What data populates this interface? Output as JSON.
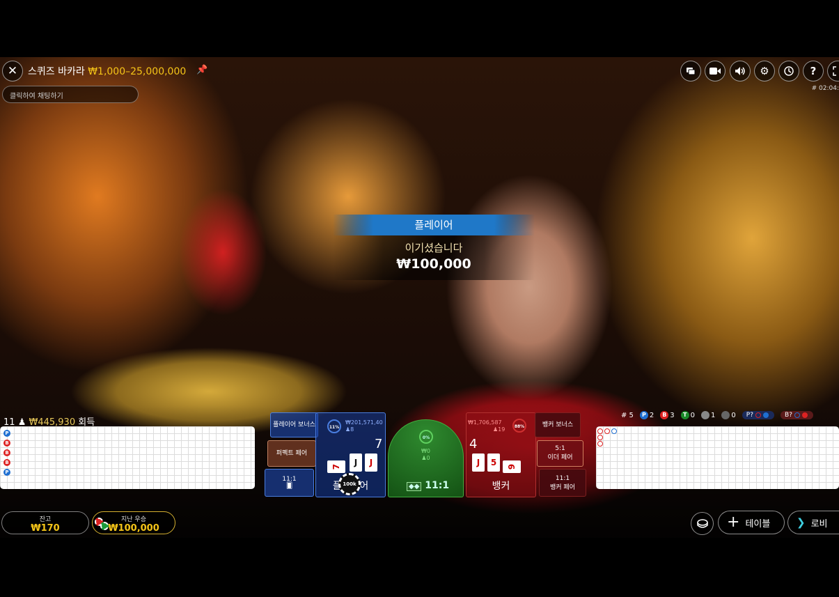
{
  "header": {
    "title": "스퀴즈 바카라",
    "limits": "₩1,000–25,000,000",
    "chat_placeholder": "클릭하여 채팅하기",
    "game_id": "# 02:04:"
  },
  "toolbar_icons": [
    "chat-icon",
    "video-icon",
    "volume-icon",
    "settings-icon",
    "history-icon",
    "help-icon",
    "fullscreen-icon"
  ],
  "result": {
    "banner": "플레이어",
    "message": "이기셨습니다",
    "amount": "₩100,000"
  },
  "history": {
    "count": "11",
    "amount": "₩445,930",
    "label": "회득"
  },
  "bead_road": [
    "P",
    "B",
    "B",
    "B",
    "P"
  ],
  "stats": {
    "round": "# 5",
    "player": "2",
    "banker": "3",
    "tie": "0",
    "p_pair": "1",
    "b_pair": "0",
    "player_ask": "P?",
    "banker_ask": "B?"
  },
  "bets": {
    "player_bonus": "플레이어 보너스",
    "perfect_pair": "퍼펙트 페어",
    "player_pair_ratio": "11:1",
    "either_pair_ratio": "5:1",
    "either_pair": "이더 페어",
    "banker_bonus": "뱅커 보너스",
    "banker_pair_ratio": "11:1",
    "banker_pair": "뱅커 페어"
  },
  "player_spot": {
    "pct": "11%",
    "amount": "₩201,571,40",
    "players": "8",
    "score": "7",
    "label": "플레이어",
    "chip": "100k"
  },
  "tie_spot": {
    "pct": "0%",
    "amount": "₩0",
    "players": "0",
    "ratio": "11:1"
  },
  "banker_spot": {
    "pct": "88%",
    "amount": "₩1,706,587",
    "players": "19",
    "score": "4",
    "label": "뱅커"
  },
  "player_cards": [
    "7",
    "J",
    "J"
  ],
  "banker_cards": [
    "J",
    "5",
    "9"
  ],
  "bottom": {
    "balance_label": "잔고",
    "balance": "₩170",
    "lastwin_label": "지난 우승",
    "lastwin": "₩100,000",
    "table_label": "테이블",
    "lobby_label": "로비"
  },
  "colors": {
    "accent_gold": "#f5c518",
    "player_blue": "#1f6fd1",
    "banker_red": "#d22222",
    "tie_green": "#1a7a1a"
  }
}
